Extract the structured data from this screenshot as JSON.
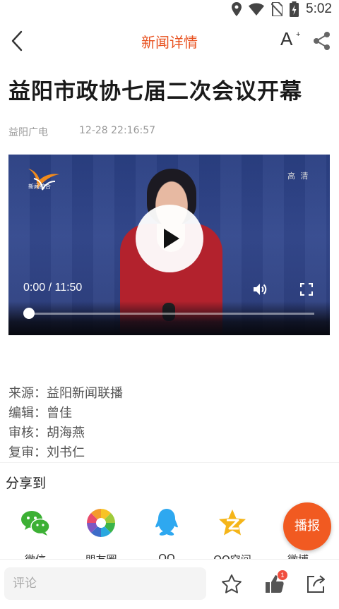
{
  "status_bar": {
    "time": "5:02"
  },
  "header": {
    "title": "新闻详情",
    "font_button_label": "A",
    "font_button_sup": "+"
  },
  "article": {
    "title": "益阳市政协七届二次会议开幕",
    "source_name": "益阳广电",
    "datetime": "12-28 22:16:57"
  },
  "video": {
    "channel_logo_text": "新闻综合",
    "quality_tag": "高 清",
    "time_display": "0:00 / 11:50",
    "progress_fraction": 0
  },
  "credits": [
    {
      "label": "来源：",
      "value": "益阳新闻联播"
    },
    {
      "label": "编辑：",
      "value": "曾佳"
    },
    {
      "label": "审核：",
      "value": "胡海燕"
    },
    {
      "label": "复审：",
      "value": "刘书仁"
    }
  ],
  "share": {
    "title": "分享到",
    "items": [
      {
        "label": "微信",
        "icon": "wechat-icon"
      },
      {
        "label": "朋友圈",
        "icon": "moments-icon"
      },
      {
        "label": "QQ",
        "icon": "qq-icon"
      },
      {
        "label": "QQ空间",
        "icon": "qzone-icon"
      },
      {
        "label": "微博",
        "icon": "weibo-icon"
      }
    ]
  },
  "broadcast_button": "播报",
  "bottom_bar": {
    "comment_placeholder": "评论",
    "like_count": "1"
  },
  "colors": {
    "accent": "#e8511f",
    "broadcast": "#f15a21",
    "badge": "#f04e3e"
  }
}
